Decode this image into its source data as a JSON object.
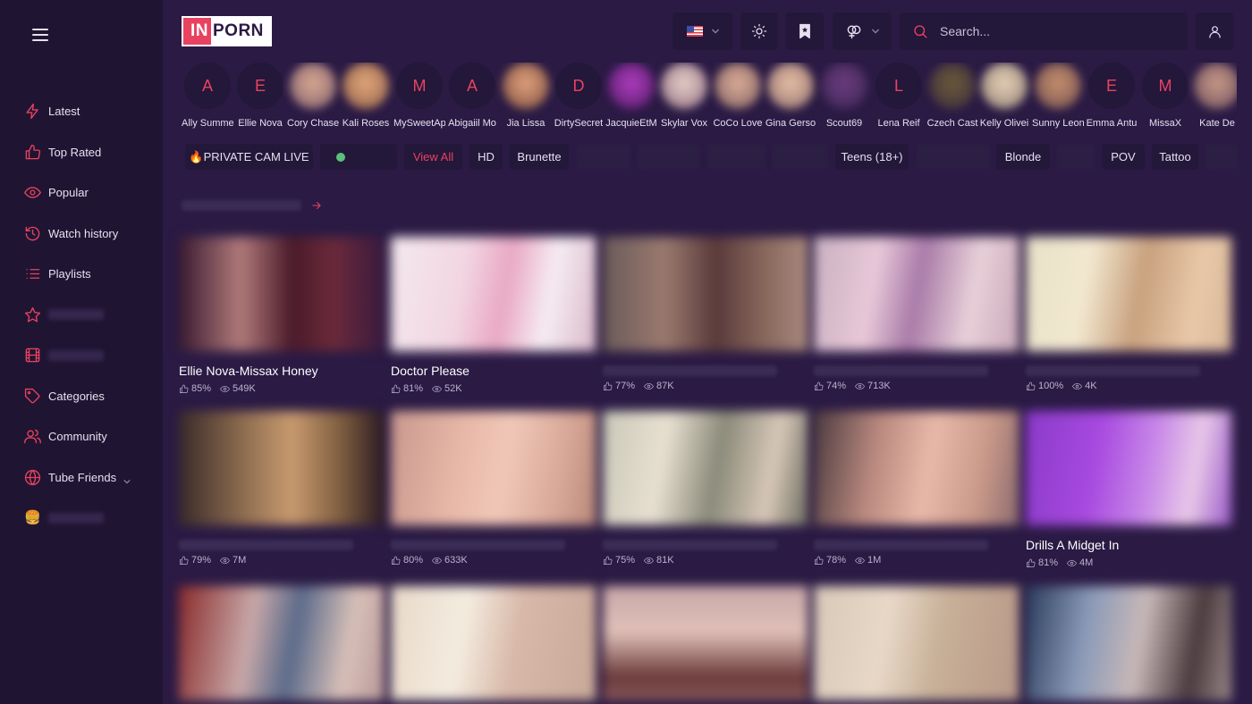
{
  "header": {
    "logo_in": "IN",
    "logo_porn": "PORN",
    "search_placeholder": "Search..."
  },
  "sidebar": {
    "items": [
      {
        "label": "Latest",
        "icon": "bolt-icon"
      },
      {
        "label": "Top Rated",
        "icon": "thumbs-up-icon"
      },
      {
        "label": "Popular",
        "icon": "eye-icon"
      },
      {
        "label": "Watch history",
        "icon": "history-icon"
      },
      {
        "label": "Playlists",
        "icon": "list-icon"
      },
      {
        "label": "",
        "icon": "star-icon"
      },
      {
        "label": "",
        "icon": "film-icon"
      },
      {
        "label": "Categories",
        "icon": "tag-icon"
      },
      {
        "label": "Community",
        "icon": "users-icon"
      },
      {
        "label": "Tube Friends",
        "icon": "globe-icon"
      },
      {
        "label": "",
        "icon": "emoji-icon"
      }
    ]
  },
  "models": [
    {
      "letter": "A",
      "name": "Ally Summe"
    },
    {
      "letter": "E",
      "name": "Ellie Nova"
    },
    {
      "letter": "",
      "name": "Cory Chase"
    },
    {
      "letter": "",
      "name": "Kali Roses"
    },
    {
      "letter": "M",
      "name": "MySweetAp"
    },
    {
      "letter": "A",
      "name": "Abigaiil Mo"
    },
    {
      "letter": "",
      "name": "Jia Lissa"
    },
    {
      "letter": "D",
      "name": "DirtySecret"
    },
    {
      "letter": "",
      "name": "JacquieEtM"
    },
    {
      "letter": "",
      "name": "Skylar Vox"
    },
    {
      "letter": "",
      "name": "CoCo Love"
    },
    {
      "letter": "",
      "name": "Gina Gerso"
    },
    {
      "letter": "",
      "name": "Scout69"
    },
    {
      "letter": "L",
      "name": "Lena Reif"
    },
    {
      "letter": "",
      "name": "Czech Cast"
    },
    {
      "letter": "",
      "name": "Kelly Olivei"
    },
    {
      "letter": "",
      "name": "Sunny Leon"
    },
    {
      "letter": "E",
      "name": "Emma Antu"
    },
    {
      "letter": "M",
      "name": "MissaX"
    },
    {
      "letter": "",
      "name": "Kate De"
    }
  ],
  "tags": {
    "private_cam": "🔥PRIVATE CAM LIVE",
    "view_all": "View All",
    "hd": "HD",
    "brunette": "Brunette",
    "teens": "Teens (18+)",
    "blonde": "Blonde",
    "pov": "POV",
    "tattoo": "Tattoo"
  },
  "videos": [
    {
      "title": "Ellie Nova-Missax Honey",
      "rating": "85%",
      "views": "549K"
    },
    {
      "title": "Doctor Please",
      "rating": "81%",
      "views": "52K"
    },
    {
      "title": "",
      "rating": "77%",
      "views": "87K"
    },
    {
      "title": "",
      "rating": "74%",
      "views": "713K"
    },
    {
      "title": "",
      "rating": "100%",
      "views": "4K"
    },
    {
      "title": "",
      "rating": "79%",
      "views": "7M"
    },
    {
      "title": "",
      "rating": "80%",
      "views": "633K"
    },
    {
      "title": "",
      "rating": "75%",
      "views": "81K"
    },
    {
      "title": "",
      "rating": "78%",
      "views": "1M"
    },
    {
      "title": "Drills A Midget In",
      "rating": "81%",
      "views": "4M"
    },
    {
      "title": "",
      "rating": "",
      "views": ""
    },
    {
      "title": "",
      "rating": "",
      "views": ""
    },
    {
      "title": "",
      "rating": "",
      "views": ""
    },
    {
      "title": "",
      "rating": "",
      "views": ""
    },
    {
      "title": "",
      "rating": "",
      "views": ""
    }
  ],
  "colors": {
    "background": "#2a1a44",
    "sidebar": "#1f1533",
    "accent": "#e94260",
    "panel": "#23173a"
  }
}
